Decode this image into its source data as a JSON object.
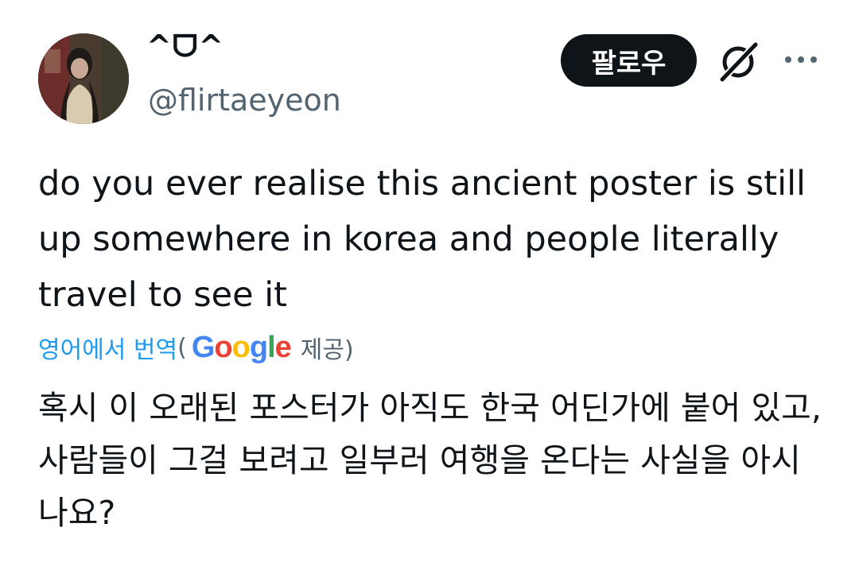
{
  "author": {
    "display_name": "^ᗜ^",
    "handle": "@flirtaeyeon"
  },
  "actions": {
    "follow_label": "팔로우",
    "grok_icon": "grok-icon",
    "more_icon": "more-horizontal-icon"
  },
  "tweet": {
    "text": "do you ever realise this ancient poster is still up somewhere in korea and people literally travel to see it"
  },
  "translation": {
    "link_label": "영어에서 번역",
    "open_paren": "(",
    "provider_logo": "Google",
    "provided_by": "제공)",
    "text": "혹시 이 오래된 포스터가 아직도 한국 어딘가에 붙어 있고, 사람들이 그걸 보려고 일부러 여행을 온다는 사실을 아시나요?"
  },
  "colors": {
    "text_primary": "#0f1419",
    "text_secondary": "#536471",
    "link": "#1d9bf0",
    "button_bg": "#0f1419",
    "google_blue": "#4285f4",
    "google_red": "#ea4335",
    "google_yellow": "#fbbc05",
    "google_green": "#34a853"
  }
}
